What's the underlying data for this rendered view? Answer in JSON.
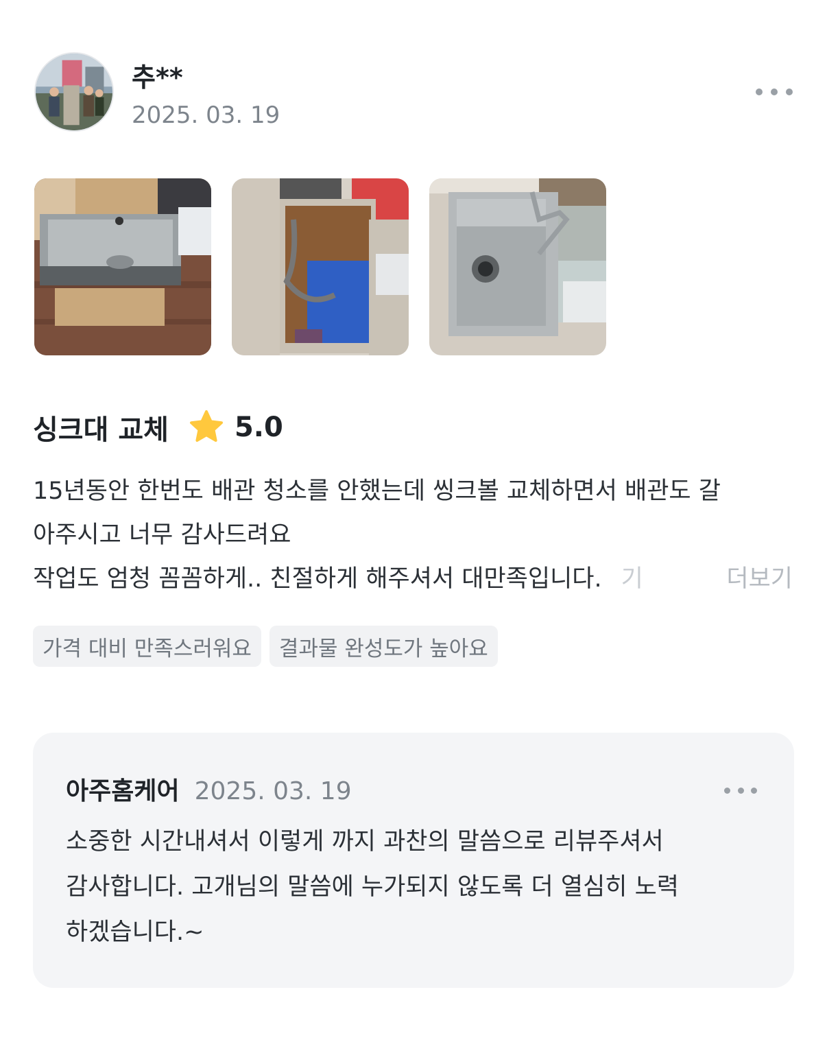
{
  "review": {
    "author": "추**",
    "date": "2025. 03. 19",
    "avatar_icon": "profile-photo",
    "photos": [
      {
        "name": "sink-in-box-photo"
      },
      {
        "name": "cabinet-under-sink-photo"
      },
      {
        "name": "installed-sink-photo"
      }
    ],
    "title": "싱크대 교체",
    "rating": "5.0",
    "star_color": "#FFC83D",
    "body_lines": [
      "15년동안 한번도 배관 청소를 안했는데 씽크볼 교체하면서 배관도 갈",
      "아주시고 너무 감사드려요",
      "작업도 엄청 꼼꼼하게.. 친절하게 해주셔서 대만족입니다."
    ],
    "body_fade": "기",
    "more_label": "더보기",
    "tags": [
      "가격 대비 만족스러워요",
      "결과물 완성도가 높아요"
    ]
  },
  "reply": {
    "author": "아주홈케어",
    "date": "2025. 03. 19",
    "lines": [
      "소중한 시간내셔서 이렇게 까지 과찬의 말씀으로 리뷰주셔서",
      "감사합니다. 고개님의 말씀에 누가되지 않도록 더 열심히 노력",
      "하겠습니다.~"
    ]
  }
}
